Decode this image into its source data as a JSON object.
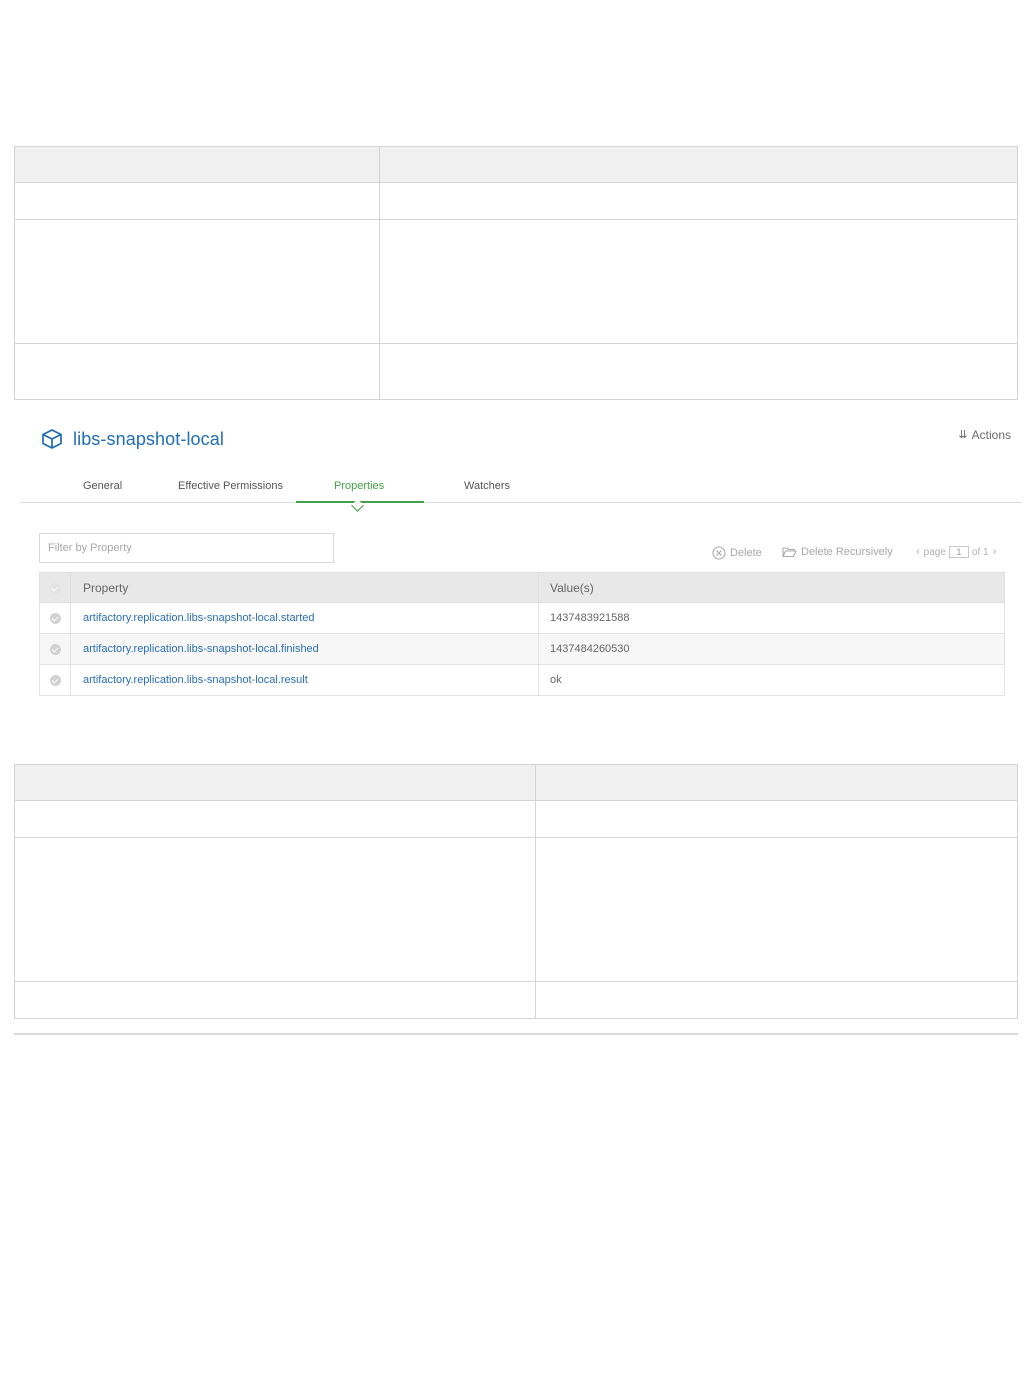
{
  "repository": {
    "name": "libs-snapshot-local",
    "icon": "package-cube-icon",
    "actions_label": "Actions"
  },
  "tabs": [
    {
      "label": "General",
      "active": false
    },
    {
      "label": "Effective Permissions",
      "active": false
    },
    {
      "label": "Properties",
      "active": true
    },
    {
      "label": "Watchers",
      "active": false
    }
  ],
  "filter": {
    "placeholder": "Filter by Property",
    "value": ""
  },
  "toolbar": {
    "delete_label": "Delete",
    "delete_recursively_label": "Delete Recursively"
  },
  "pager": {
    "page_label": "page",
    "current_page": "1",
    "of_label": "of 1"
  },
  "properties_table": {
    "headers": {
      "property": "Property",
      "values": "Value(s)"
    },
    "rows": [
      {
        "property": "artifactory.replication.libs-snapshot-local.started",
        "value": "1437483921588"
      },
      {
        "property": "artifactory.replication.libs-snapshot-local.finished",
        "value": "1437484260530"
      },
      {
        "property": "artifactory.replication.libs-snapshot-local.result",
        "value": "ok"
      }
    ]
  },
  "colors": {
    "link_blue": "#1f6db4",
    "active_tab_green": "#43a047",
    "table_header_gray": "#e8e8e8"
  }
}
